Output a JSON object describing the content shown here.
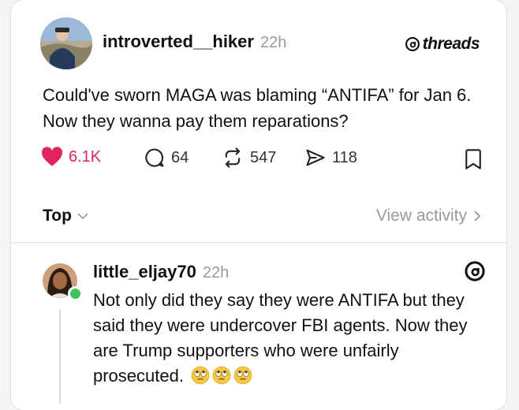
{
  "post": {
    "username": "introverted__hiker",
    "timestamp": "22h",
    "brand": "threads",
    "text": "Could've sworn MAGA was blaming “ANTIFA” for Jan 6. Now they wanna pay them reparations?",
    "stats": {
      "likes": "6.1K",
      "comments": "64",
      "reposts": "547",
      "shares": "118"
    },
    "colors": {
      "like": "#e0245e"
    }
  },
  "replies_bar": {
    "sort_label": "Top",
    "view_activity": "View activity"
  },
  "reply": {
    "username": "little_eljay70",
    "timestamp": "22h",
    "text": "Not only did they say they were ANTIFA but they said they were undercover FBI agents. Now they are Trump supporters who were unfairly prosecuted.",
    "emojis": [
      "eye-roll-emoji",
      "eye-roll-emoji",
      "eye-roll-emoji"
    ],
    "online_status_color": "#3ec25b"
  }
}
